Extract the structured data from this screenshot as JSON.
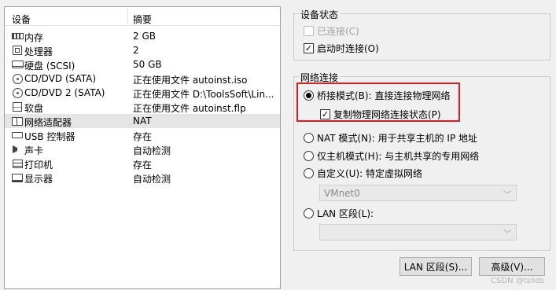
{
  "device_list": {
    "header": {
      "device": "设备",
      "summary": "摘要"
    },
    "rows": [
      {
        "icon": "memory-icon",
        "name": "内存",
        "summary": "2 GB",
        "selected": false
      },
      {
        "icon": "processor-icon",
        "name": "处理器",
        "summary": "2",
        "selected": false
      },
      {
        "icon": "hard-disk-icon",
        "name": "硬盘 (SCSI)",
        "summary": "50 GB",
        "selected": false
      },
      {
        "icon": "cd-dvd-icon",
        "name": "CD/DVD (SATA)",
        "summary": "正在使用文件 autoinst.iso",
        "selected": false
      },
      {
        "icon": "cd-dvd-icon",
        "name": "CD/DVD 2 (SATA)",
        "summary": "正在使用文件 D:\\ToolsSoft\\Lin...",
        "selected": false
      },
      {
        "icon": "floppy-icon",
        "name": "软盘",
        "summary": "正在使用文件 autoinst.flp",
        "selected": false
      },
      {
        "icon": "network-adapter-icon",
        "name": "网络适配器",
        "summary": "NAT",
        "selected": true
      },
      {
        "icon": "usb-controller-icon",
        "name": "USB 控制器",
        "summary": "存在",
        "selected": false
      },
      {
        "icon": "sound-card-icon",
        "name": "声卡",
        "summary": "自动检测",
        "selected": false
      },
      {
        "icon": "printer-icon",
        "name": "打印机",
        "summary": "存在",
        "selected": false
      },
      {
        "icon": "display-icon",
        "name": "显示器",
        "summary": "自动检测",
        "selected": false
      }
    ]
  },
  "device_status": {
    "title": "设备状态",
    "connected": {
      "label": "已连接(C)",
      "checked": false,
      "enabled": false
    },
    "connect_at_power_on": {
      "label": "启动时连接(O)",
      "checked": true,
      "enabled": true
    }
  },
  "network_connection": {
    "title": "网络连接",
    "bridged": {
      "label": "桥接模式(B): 直接连接物理网络",
      "selected": true
    },
    "replicate_state": {
      "label": "复制物理网络连接状态(P)",
      "checked": true
    },
    "nat": {
      "label": "NAT 模式(N): 用于共享主机的 IP 地址",
      "selected": false
    },
    "host_only": {
      "label": "仅主机模式(H): 与主机共享的专用网络",
      "selected": false
    },
    "custom": {
      "label": "自定义(U): 特定虚拟网络",
      "selected": false,
      "combo_value": "VMnet0"
    },
    "lan_segment": {
      "label": "LAN 区段(L):",
      "selected": false,
      "combo_value": ""
    }
  },
  "buttons": {
    "lan_segments": "LAN 区段(S)...",
    "advanced": "高级(V)..."
  },
  "watermark": "CSDN @tslids",
  "colors": {
    "highlight_border": "#d81e1e",
    "selected_row": "#e5e5e5"
  }
}
